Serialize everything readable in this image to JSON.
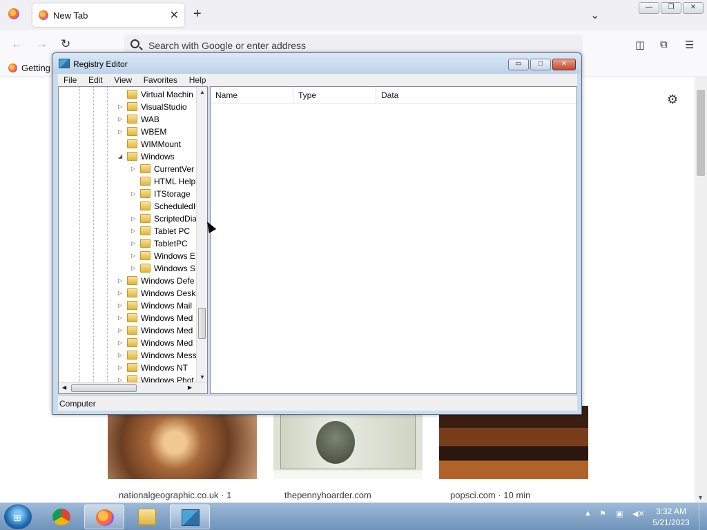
{
  "browser": {
    "tab_title": "New Tab",
    "tab_close_glyph": "✕",
    "new_tab_glyph": "+",
    "list_all_tabs_glyph": "⌄",
    "window_controls": {
      "minimize": "—",
      "restore": "❐",
      "close": "✕"
    },
    "address_placeholder": "Search with Google or enter address",
    "bookmark_label": "Getting",
    "colors": {
      "toolbar": "#f9f9fb",
      "tabstrip": "#f0f0f4"
    }
  },
  "new_tab_page": {
    "cards": [
      {
        "source": "nationalgeographic.co.uk · 1"
      },
      {
        "source": "thepennyhoarder.com"
      },
      {
        "source": "popsci.com · 10 min"
      }
    ]
  },
  "regedit": {
    "title": "Registry Editor",
    "controls": {
      "minimize": "▭",
      "maximize": "□",
      "close": "✕"
    },
    "menu": [
      "File",
      "Edit",
      "View",
      "Favorites",
      "Help"
    ],
    "tree": [
      {
        "label": "Virtual Machin",
        "level": 1,
        "expander": ""
      },
      {
        "label": "VisualStudio",
        "level": 1,
        "expander": "▷"
      },
      {
        "label": "WAB",
        "level": 1,
        "expander": "▷"
      },
      {
        "label": "WBEM",
        "level": 1,
        "expander": "▷"
      },
      {
        "label": "WIMMount",
        "level": 1,
        "expander": ""
      },
      {
        "label": "Windows",
        "level": 1,
        "expander": "◢"
      },
      {
        "label": "CurrentVer",
        "level": 2,
        "expander": "▷"
      },
      {
        "label": "HTML Help",
        "level": 2,
        "expander": ""
      },
      {
        "label": "ITStorage",
        "level": 2,
        "expander": "▷"
      },
      {
        "label": "ScheduledI",
        "level": 2,
        "expander": ""
      },
      {
        "label": "ScriptedDia",
        "level": 2,
        "expander": "▷"
      },
      {
        "label": "Tablet PC",
        "level": 2,
        "expander": "▷"
      },
      {
        "label": "TabletPC",
        "level": 2,
        "expander": "▷"
      },
      {
        "label": "Windows E",
        "level": 2,
        "expander": "▷"
      },
      {
        "label": "Windows S",
        "level": 2,
        "expander": "▷"
      },
      {
        "label": "Windows Defe",
        "level": 1,
        "expander": "▷"
      },
      {
        "label": "Windows Desk",
        "level": 1,
        "expander": "▷"
      },
      {
        "label": "Windows Mail",
        "level": 1,
        "expander": "▷"
      },
      {
        "label": "Windows Med",
        "level": 1,
        "expander": "▷"
      },
      {
        "label": "Windows Med",
        "level": 1,
        "expander": "▷"
      },
      {
        "label": "Windows Med",
        "level": 1,
        "expander": "▷"
      },
      {
        "label": "Windows Mess",
        "level": 1,
        "expander": "▷"
      },
      {
        "label": "Windows NT",
        "level": 1,
        "expander": "▷"
      },
      {
        "label": "Windows Phot",
        "level": 1,
        "expander": "▷"
      }
    ],
    "columns": [
      "Name",
      "Type",
      "Data"
    ],
    "status": "Computer"
  },
  "taskbar": {
    "apps": [
      "chrome",
      "firefox",
      "file-explorer",
      "registry-editor"
    ],
    "clock_time": "3:32 AM",
    "clock_date": "5/21/2023"
  }
}
